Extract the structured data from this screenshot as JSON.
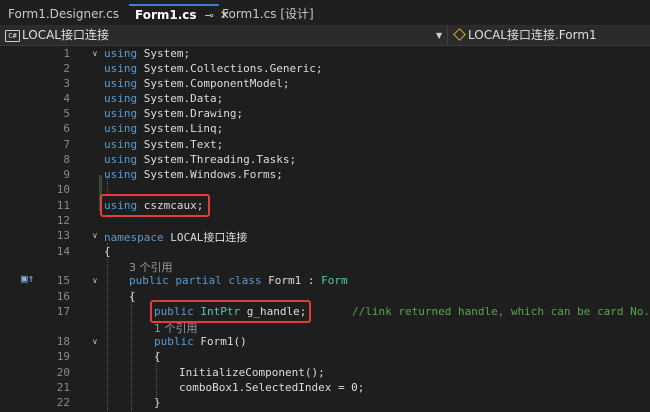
{
  "tabs": [
    {
      "label": "Form1.Designer.cs",
      "active": false
    },
    {
      "label": "Form1.cs",
      "active": true,
      "pin_glyph": "⊸",
      "close_glyph": "✕"
    },
    {
      "label": "Form1.cs [设计]",
      "active": false
    }
  ],
  "navbar": {
    "left_icon": "csharp-project-icon",
    "left_icon_text": "C#",
    "left_label": "LOCAL接口连接",
    "right_icon": "class-icon",
    "right_label": "LOCAL接口连接.Form1"
  },
  "code_lines": [
    {
      "num": "1",
      "text": "using System;"
    },
    {
      "num": "2",
      "text": "using System.Collections.Generic;"
    },
    {
      "num": "3",
      "text": "using System.ComponentModel;"
    },
    {
      "num": "4",
      "text": "using System.Data;"
    },
    {
      "num": "5",
      "text": "using System.Drawing;"
    },
    {
      "num": "6",
      "text": "using System.Linq;"
    },
    {
      "num": "7",
      "text": "using System.Text;"
    },
    {
      "num": "8",
      "text": "using System.Threading.Tasks;"
    },
    {
      "num": "9",
      "text": "using System.Windows.Forms;"
    },
    {
      "num": "10",
      "text": ""
    },
    {
      "num": "11",
      "text": "using cszmcaux;"
    },
    {
      "num": "12",
      "text": ""
    },
    {
      "num": "13",
      "text": "namespace LOCAL接口连接"
    },
    {
      "num": "14",
      "text": "{"
    },
    {
      "num": "15",
      "text": "public partial class Form1 : Form"
    },
    {
      "num": "16",
      "text": "{"
    },
    {
      "num": "17",
      "text": "public IntPtr g_handle;",
      "comment": "//link returned handle, which can be card No."
    },
    {
      "num": "18",
      "text": "public Form1()"
    },
    {
      "num": "19",
      "text": "{"
    },
    {
      "num": "20",
      "text": "InitializeComponent();"
    },
    {
      "num": "21",
      "text": "comboBox1.SelectedIndex = 0;"
    },
    {
      "num": "22",
      "text": "}"
    }
  ],
  "codelens": [
    {
      "text": "3 个引用"
    },
    {
      "text": "1 个引用"
    }
  ],
  "tokens": {
    "using": "using",
    "namespace": "namespace",
    "public": "public",
    "partial": "partial",
    "class": "class",
    "IntPtr": "IntPtr",
    "Form": "Form"
  },
  "colors": {
    "background": "#1e1e1e",
    "keyword": "#569cd6",
    "type": "#4ec9b0",
    "comment": "#57a64a",
    "highlight_box": "#e33c3c",
    "active_tab_accent": "#3c7bd9"
  }
}
